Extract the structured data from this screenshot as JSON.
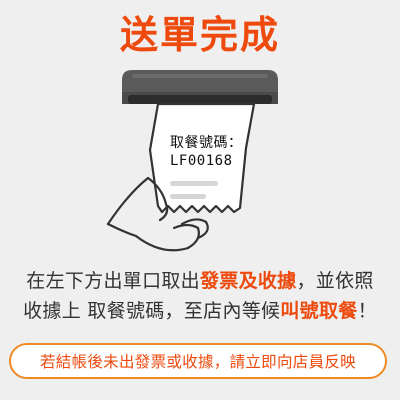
{
  "title": "送單完成",
  "receipt": {
    "label": "取餐號碼：",
    "order_code": "LF00168"
  },
  "instructions": {
    "line1_a": "在左下方出單口取出",
    "line1_highlight": "發票及收據",
    "line1_b": "，並依照",
    "line2_a": "收據上 取餐號碼，至店內等候",
    "line2_highlight": "叫號取餐",
    "line2_b": "！"
  },
  "notice": "若結帳後未出發票或收據，請立即向店員反映",
  "colors": {
    "accent": "#ee4a0e",
    "notice_border": "#f08a24",
    "background": "#efefef",
    "printer": "#555555"
  },
  "icons": {
    "printer": "printer-slot-icon",
    "receipt": "receipt-paper-icon",
    "hand": "hand-holding-icon"
  }
}
